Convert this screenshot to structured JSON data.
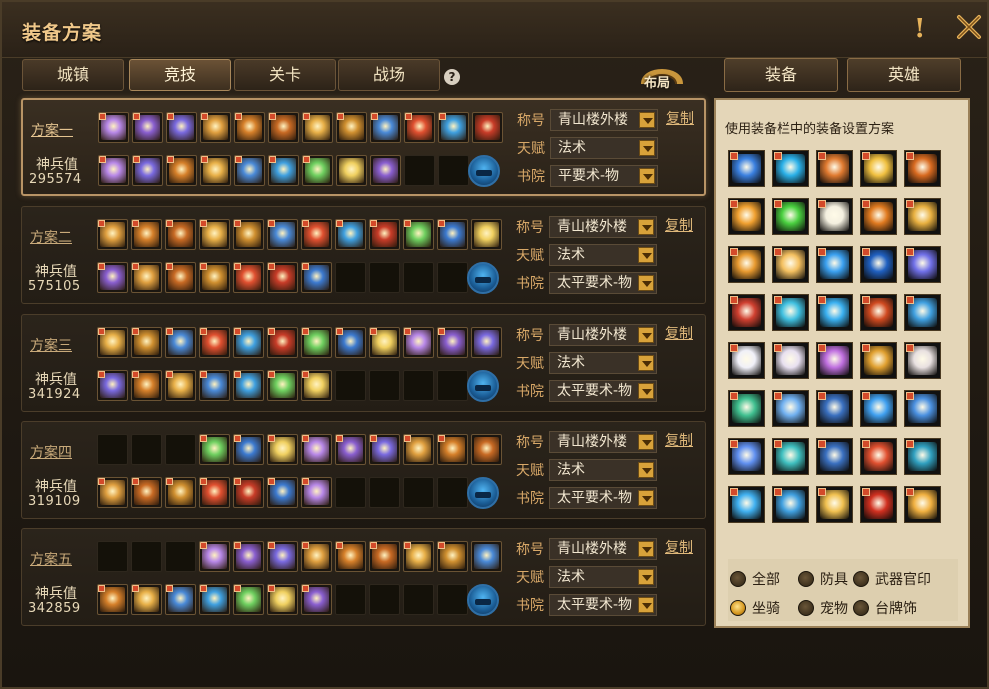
{
  "window": {
    "title": "装备方案",
    "help_glyph": "?",
    "alert_glyph": "!"
  },
  "tabs": [
    {
      "label": "城镇",
      "active": false
    },
    {
      "label": "竞技",
      "active": true
    },
    {
      "label": "关卡",
      "active": false
    },
    {
      "label": "战场",
      "active": false
    }
  ],
  "layout_button": {
    "label": "布局"
  },
  "right_tabs": [
    {
      "label": "装备"
    },
    {
      "label": "英雄"
    }
  ],
  "right_panel": {
    "hint": "使用装备栏中的装备设置方案",
    "filters": [
      {
        "label": "全部",
        "selected": false
      },
      {
        "label": "防具",
        "selected": false
      },
      {
        "label": "武器官印",
        "selected": false
      },
      {
        "label": "坐骑",
        "selected": true
      },
      {
        "label": "宠物",
        "selected": false
      },
      {
        "label": "台牌饰",
        "selected": false
      }
    ]
  },
  "field_labels": {
    "title": "称号",
    "talent": "天赋",
    "academy": "书院",
    "power": "神兵值",
    "copy": "复制"
  },
  "plans": [
    {
      "name": "方案一",
      "power": "295574",
      "title_value": "青山楼外楼",
      "talent_value": "法术",
      "academy_value": "平要术-物",
      "active": true
    },
    {
      "name": "方案二",
      "power": "575105",
      "title_value": "青山楼外楼",
      "talent_value": "法术",
      "academy_value": "太平要术-物",
      "active": false
    },
    {
      "name": "方案三",
      "power": "341924",
      "title_value": "青山楼外楼",
      "talent_value": "法术",
      "academy_value": "太平要术-物",
      "active": false
    },
    {
      "name": "方案四",
      "power": "319109",
      "title_value": "青山楼外楼",
      "talent_value": "法术",
      "academy_value": "太平要术-物",
      "active": false
    },
    {
      "name": "方案五",
      "power": "342859",
      "title_value": "青山楼外楼",
      "talent_value": "法术",
      "academy_value": "太平要术-物",
      "active": false
    }
  ],
  "colors": {
    "accent": "#d8a868",
    "panel_bg": "#e4d6b8",
    "active_border": "#b89466",
    "frame": "#4a3c28"
  }
}
